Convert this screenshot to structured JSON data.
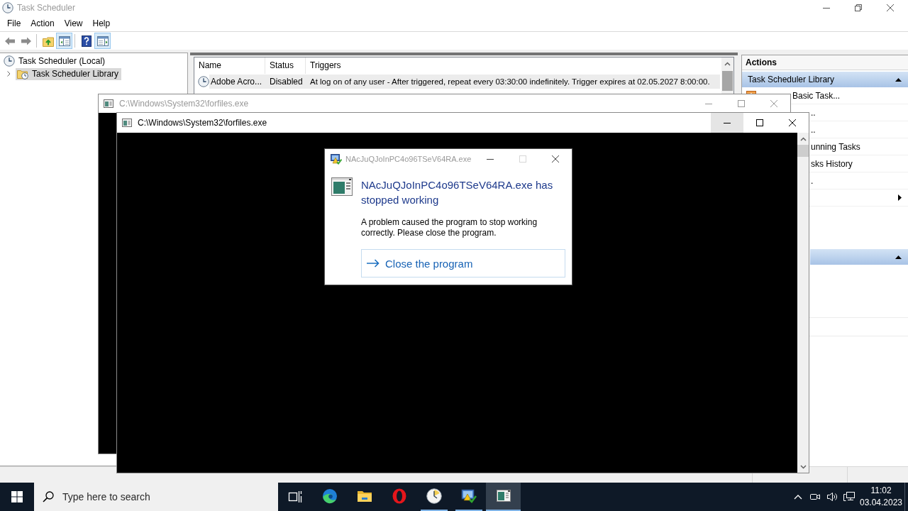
{
  "task_scheduler": {
    "title": "Task Scheduler",
    "active": false,
    "menu": [
      "File",
      "Action",
      "View",
      "Help"
    ],
    "toolbar": [
      {
        "buttons": [
          {
            "kind": "back",
            "on": false
          },
          {
            "kind": "forward",
            "on": false
          }
        ]
      },
      {
        "buttons": [
          {
            "kind": "up",
            "on": false
          },
          {
            "kind": "console_tree",
            "on": true
          }
        ]
      },
      {
        "buttons": [
          {
            "kind": "help",
            "on": false
          },
          {
            "kind": "action_pane",
            "on": true
          }
        ]
      }
    ],
    "tree": [
      {
        "label": "Task Scheduler (Local)",
        "selected": false,
        "children": [
          {
            "label": "Task Scheduler Library",
            "selected": true,
            "expanded": false
          }
        ]
      }
    ],
    "table": {
      "columns": [
        "Name",
        "Status",
        "Triggers"
      ],
      "rows": [
        {
          "name": "Adobe Acro...",
          "status": "Disabled",
          "triggers": "At log on of any user - After triggered, repeat every 03:30:00 indefinitely. Trigger expires at 02.05.2027 8:00:00.",
          "selected": true
        }
      ]
    },
    "actions": {
      "title": "Actions",
      "sections": [
        {
          "title": "Task Scheduler Library",
          "expanded": true,
          "items": [
            {
              "kind": "icon",
              "label": "Basic Task..."
            },
            {
              "kind": "text",
              "label": ".."
            },
            {
              "kind": "text",
              "label": ".."
            },
            {
              "kind": "text",
              "label": "unning Tasks"
            },
            {
              "kind": "text",
              "label": "sks History"
            },
            {
              "kind": "text",
              "label": "."
            },
            {
              "kind": "submenu"
            }
          ]
        },
        {
          "expanded": true
        }
      ]
    }
  },
  "consoles": [
    {
      "title": "C:\\Windows\\System32\\forfiles.exe",
      "active": false,
      "buttons": [
        {
          "kind": "minimize",
          "hovered": false
        },
        {
          "kind": "maximize",
          "hovered": false
        },
        {
          "kind": "close",
          "hovered": false
        }
      ]
    },
    {
      "title": "C:\\Windows\\System32\\forfiles.exe",
      "active": true,
      "buttons": [
        {
          "kind": "minimize",
          "hovered": true
        },
        {
          "kind": "maximize",
          "hovered": false
        },
        {
          "kind": "close",
          "hovered": false
        }
      ]
    }
  ],
  "error_dialog": {
    "title": "NAcJuQJoInPC4o96TSeV64RA.exe",
    "active": false,
    "buttons": [
      {
        "kind": "minimize",
        "disabled": false
      },
      {
        "kind": "maximize",
        "disabled": true
      },
      {
        "kind": "close",
        "disabled": false
      }
    ],
    "heading": "NAcJuQJoInPC4o96TSeV64RA.exe has stopped working",
    "message": "A problem caused the program to stop working correctly. Please close the program.",
    "command": "Close the program"
  },
  "taskbar": {
    "search": {
      "placeholder": "Type here to search"
    },
    "apps": [
      {
        "kind": "browser",
        "running": false,
        "selected": false
      },
      {
        "kind": "file_explorer",
        "running": false,
        "selected": false
      },
      {
        "kind": "opera",
        "running": false,
        "selected": false
      },
      {
        "kind": "scheduler",
        "running": true,
        "selected": false
      },
      {
        "kind": "error_reporting",
        "running": true,
        "selected": false
      },
      {
        "kind": "console",
        "running": true,
        "selected": true
      }
    ],
    "tray": {
      "time": "11:02",
      "date": "03.04.2023"
    }
  }
}
